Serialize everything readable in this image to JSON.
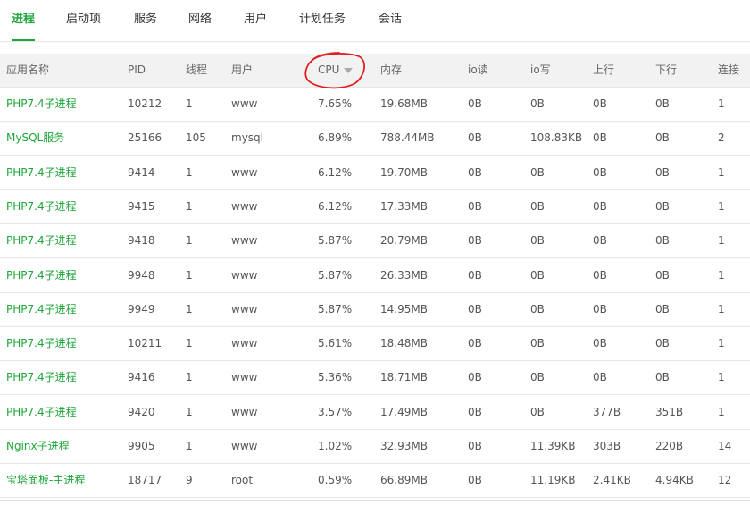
{
  "tabs": [
    "进程",
    "启动项",
    "服务",
    "网络",
    "用户",
    "计划任务",
    "会话"
  ],
  "active_tab": 0,
  "table": {
    "headers": [
      "应用名称",
      "PID",
      "线程",
      "用户",
      "CPU",
      "内存",
      "io读",
      "io写",
      "上行",
      "下行",
      "连接"
    ],
    "sorted_column": "CPU",
    "rows": [
      [
        "PHP7.4子进程",
        "10212",
        "1",
        "www",
        "7.65%",
        "19.68MB",
        "0B",
        "0B",
        "0B",
        "0B",
        "1"
      ],
      [
        "MySQL服务",
        "25166",
        "105",
        "mysql",
        "6.89%",
        "788.44MB",
        "0B",
        "108.83KB",
        "0B",
        "0B",
        "2"
      ],
      [
        "PHP7.4子进程",
        "9414",
        "1",
        "www",
        "6.12%",
        "19.70MB",
        "0B",
        "0B",
        "0B",
        "0B",
        "1"
      ],
      [
        "PHP7.4子进程",
        "9415",
        "1",
        "www",
        "6.12%",
        "17.33MB",
        "0B",
        "0B",
        "0B",
        "0B",
        "1"
      ],
      [
        "PHP7.4子进程",
        "9418",
        "1",
        "www",
        "5.87%",
        "20.79MB",
        "0B",
        "0B",
        "0B",
        "0B",
        "1"
      ],
      [
        "PHP7.4子进程",
        "9948",
        "1",
        "www",
        "5.87%",
        "26.33MB",
        "0B",
        "0B",
        "0B",
        "0B",
        "1"
      ],
      [
        "PHP7.4子进程",
        "9949",
        "1",
        "www",
        "5.87%",
        "14.95MB",
        "0B",
        "0B",
        "0B",
        "0B",
        "1"
      ],
      [
        "PHP7.4子进程",
        "10211",
        "1",
        "www",
        "5.61%",
        "18.48MB",
        "0B",
        "0B",
        "0B",
        "0B",
        "1"
      ],
      [
        "PHP7.4子进程",
        "9416",
        "1",
        "www",
        "5.36%",
        "18.71MB",
        "0B",
        "0B",
        "0B",
        "0B",
        "1"
      ],
      [
        "PHP7.4子进程",
        "9420",
        "1",
        "www",
        "3.57%",
        "17.49MB",
        "0B",
        "0B",
        "377B",
        "351B",
        "1"
      ],
      [
        "Nginx子进程",
        "9905",
        "1",
        "www",
        "1.02%",
        "32.93MB",
        "0B",
        "11.39KB",
        "303B",
        "220B",
        "14"
      ],
      [
        "宝塔面板-主进程",
        "18717",
        "9",
        "root",
        "0.59%",
        "66.89MB",
        "0B",
        "11.19KB",
        "2.41KB",
        "4.94KB",
        "12"
      ]
    ]
  },
  "colors": {
    "accent": "#20a53a",
    "annotation": "#e0201f"
  },
  "icons": {
    "sort": "caret-down-icon"
  }
}
